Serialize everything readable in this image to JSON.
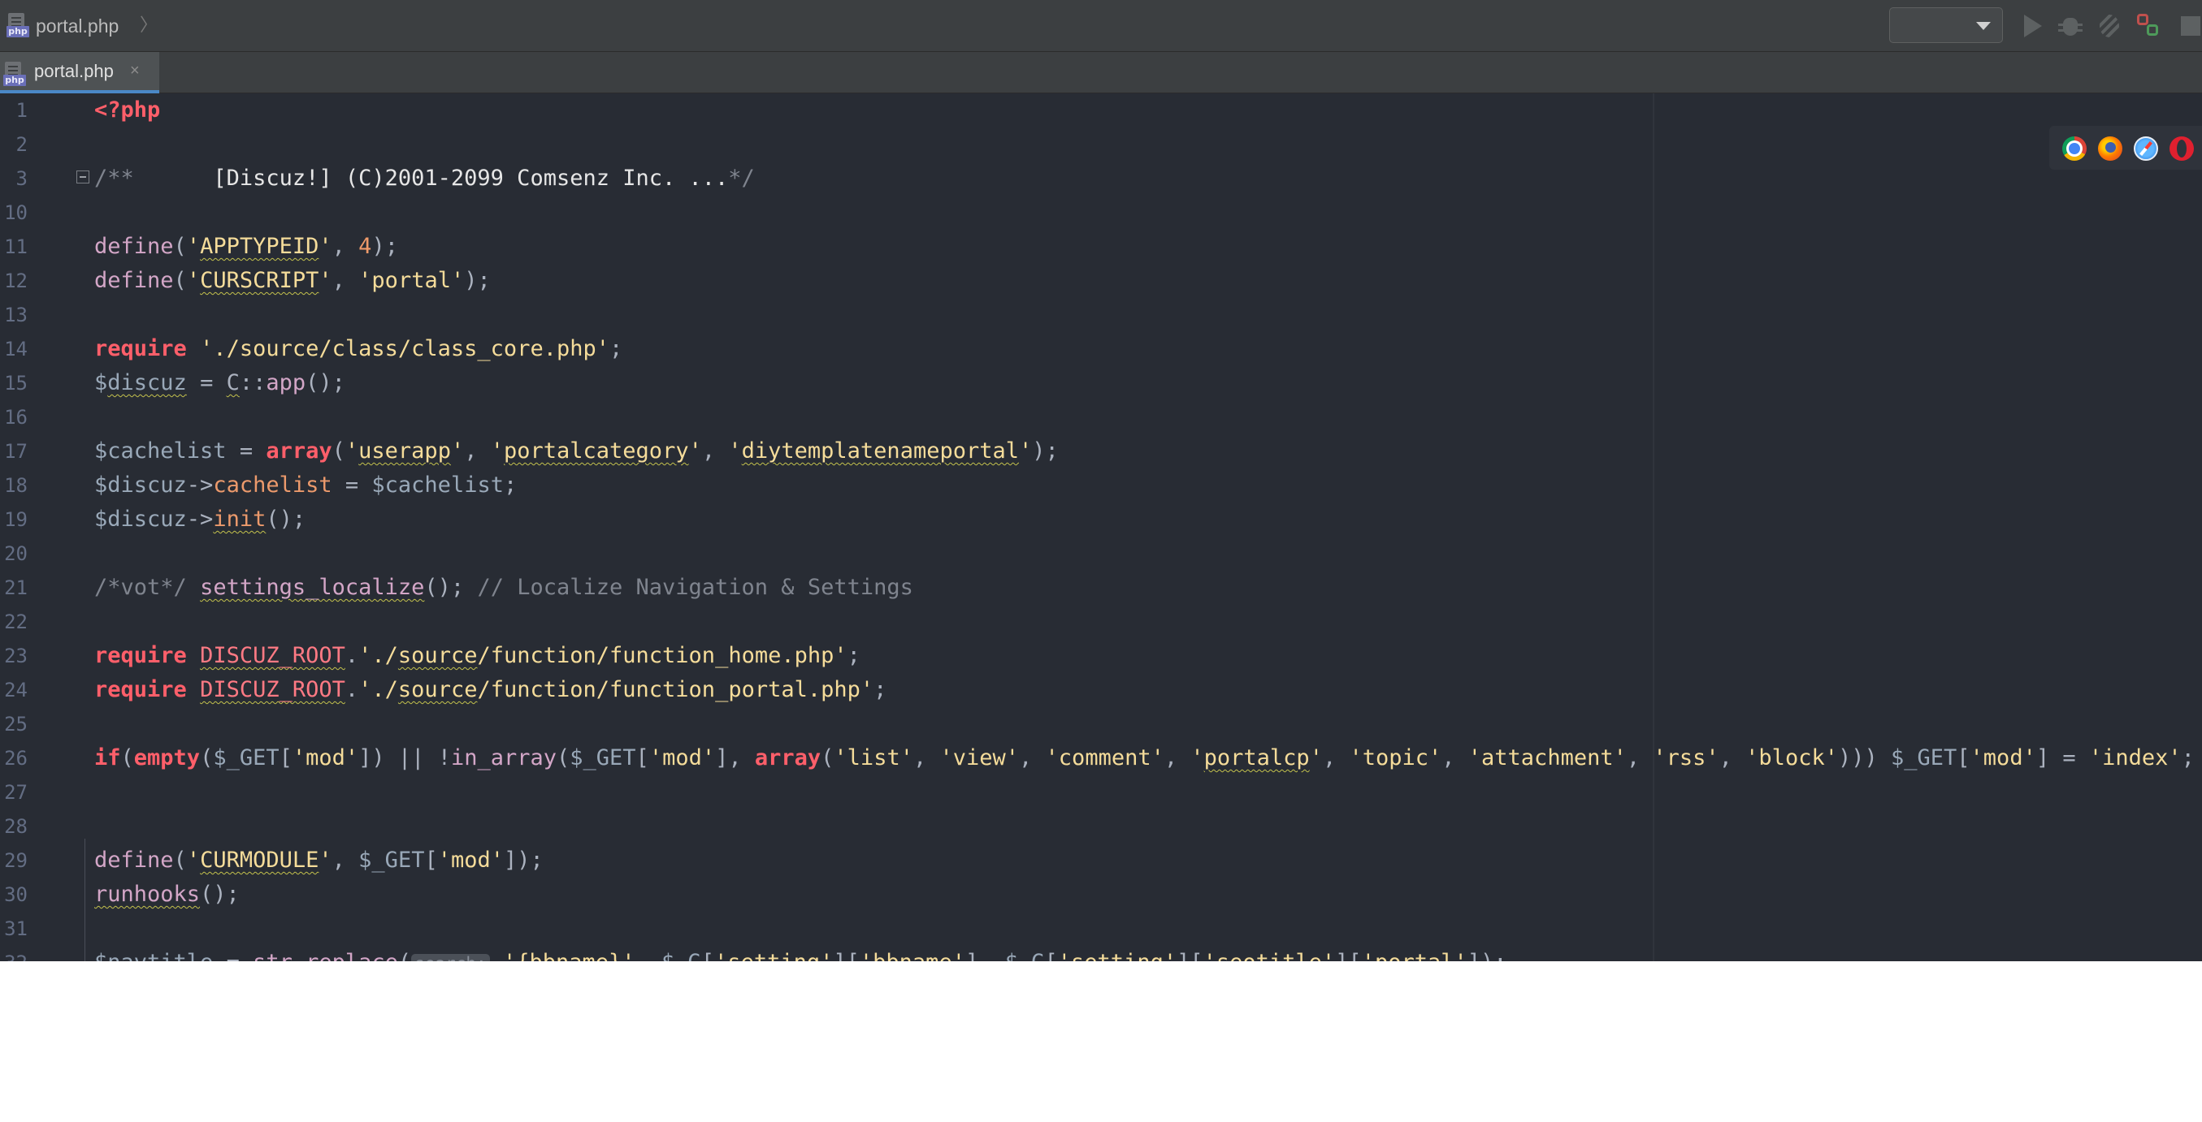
{
  "navbar": {
    "file_icon": "php-file-icon",
    "file_icon_tag": "php",
    "breadcrumb_file": "portal.php",
    "separator": "〉",
    "toolbar_icons": [
      "run-config-dropdown",
      "run-icon",
      "debug-icon",
      "profile-icon",
      "coverage-icon",
      "stop-icon"
    ]
  },
  "tabs": [
    {
      "label": "portal.php",
      "close": "×",
      "active": true,
      "icon": "php-file-icon"
    }
  ],
  "browser_icons": [
    "chrome-icon",
    "firefox-icon",
    "safari-icon",
    "opera-icon"
  ],
  "editor": {
    "lines": [
      {
        "no": "1",
        "tokens": [
          {
            "t": "<?php",
            "c": "kw"
          }
        ]
      },
      {
        "no": "2",
        "tokens": []
      },
      {
        "no": "3",
        "tokens": [
          {
            "t": "/**",
            "c": "cm"
          },
          {
            "t": "      [Discuz!] (C)2001-2099 Comsenz Inc. ...",
            "c": "cf"
          },
          {
            "t": "*/",
            "c": "cm"
          }
        ]
      },
      {
        "no": "10",
        "tokens": []
      },
      {
        "no": "11",
        "tokens": [
          {
            "t": "define",
            "c": "fn"
          },
          {
            "t": "(",
            "c": "p"
          },
          {
            "t": "'",
            "c": "s"
          },
          {
            "t": "APPTYPEID",
            "c": "s w"
          },
          {
            "t": "'",
            "c": "s"
          },
          {
            "t": ", ",
            "c": "p"
          },
          {
            "t": "4",
            "c": "n"
          },
          {
            "t": ");",
            "c": "p"
          }
        ]
      },
      {
        "no": "12",
        "tokens": [
          {
            "t": "define",
            "c": "fn"
          },
          {
            "t": "(",
            "c": "p"
          },
          {
            "t": "'",
            "c": "s"
          },
          {
            "t": "CURSCRIPT",
            "c": "s w"
          },
          {
            "t": "'",
            "c": "s"
          },
          {
            "t": ", ",
            "c": "p"
          },
          {
            "t": "'portal'",
            "c": "s"
          },
          {
            "t": ");",
            "c": "p"
          }
        ]
      },
      {
        "no": "13",
        "tokens": []
      },
      {
        "no": "14",
        "tokens": [
          {
            "t": "require",
            "c": "kw"
          },
          {
            "t": " ",
            "c": "p"
          },
          {
            "t": "'./source/class/class_core.php'",
            "c": "s"
          },
          {
            "t": ";",
            "c": "p"
          }
        ]
      },
      {
        "no": "15",
        "tokens": [
          {
            "t": "$",
            "c": "v"
          },
          {
            "t": "discuz",
            "c": "v w"
          },
          {
            "t": " = ",
            "c": "p"
          },
          {
            "t": "C",
            "c": "p w"
          },
          {
            "t": "::",
            "c": "p"
          },
          {
            "t": "app",
            "c": "fn"
          },
          {
            "t": "();",
            "c": "p"
          }
        ]
      },
      {
        "no": "16",
        "tokens": []
      },
      {
        "no": "17",
        "tokens": [
          {
            "t": "$cachelist",
            "c": "v"
          },
          {
            "t": " = ",
            "c": "p"
          },
          {
            "t": "array",
            "c": "kw"
          },
          {
            "t": "(",
            "c": "p"
          },
          {
            "t": "'",
            "c": "s"
          },
          {
            "t": "userapp",
            "c": "s w"
          },
          {
            "t": "'",
            "c": "s"
          },
          {
            "t": ", ",
            "c": "p"
          },
          {
            "t": "'",
            "c": "s"
          },
          {
            "t": "portalcategory",
            "c": "s w"
          },
          {
            "t": "'",
            "c": "s"
          },
          {
            "t": ", ",
            "c": "p"
          },
          {
            "t": "'",
            "c": "s"
          },
          {
            "t": "diytemplatenameportal",
            "c": "s w"
          },
          {
            "t": "'",
            "c": "s"
          },
          {
            "t": ");",
            "c": "p"
          }
        ]
      },
      {
        "no": "18",
        "tokens": [
          {
            "t": "$discuz",
            "c": "v"
          },
          {
            "t": "->",
            "c": "p"
          },
          {
            "t": "cachelist",
            "c": "m"
          },
          {
            "t": " = ",
            "c": "p"
          },
          {
            "t": "$cachelist",
            "c": "v"
          },
          {
            "t": ";",
            "c": "p"
          }
        ]
      },
      {
        "no": "19",
        "tokens": [
          {
            "t": "$discuz",
            "c": "v"
          },
          {
            "t": "->",
            "c": "p"
          },
          {
            "t": "init",
            "c": "m w"
          },
          {
            "t": "();",
            "c": "p"
          }
        ]
      },
      {
        "no": "20",
        "tokens": []
      },
      {
        "no": "21",
        "tokens": [
          {
            "t": "/*vot*/",
            "c": "cm"
          },
          {
            "t": " ",
            "c": "p"
          },
          {
            "t": "settings_localize",
            "c": "fn w"
          },
          {
            "t": "(); ",
            "c": "p"
          },
          {
            "t": "// Localize Navigation & Settings",
            "c": "cm"
          }
        ]
      },
      {
        "no": "22",
        "tokens": []
      },
      {
        "no": "23",
        "tokens": [
          {
            "t": "require",
            "c": "kw"
          },
          {
            "t": " ",
            "c": "p"
          },
          {
            "t": "DISCUZ_ROOT",
            "c": "cn w"
          },
          {
            "t": ".",
            "c": "p"
          },
          {
            "t": "'./",
            "c": "s"
          },
          {
            "t": "source",
            "c": "s w"
          },
          {
            "t": "/function/function_home.php'",
            "c": "s"
          },
          {
            "t": ";",
            "c": "p"
          }
        ]
      },
      {
        "no": "24",
        "tokens": [
          {
            "t": "require",
            "c": "kw"
          },
          {
            "t": " ",
            "c": "p"
          },
          {
            "t": "DISCUZ_ROOT",
            "c": "cn w"
          },
          {
            "t": ".",
            "c": "p"
          },
          {
            "t": "'./",
            "c": "s"
          },
          {
            "t": "source",
            "c": "s w"
          },
          {
            "t": "/function/function_portal.php'",
            "c": "s"
          },
          {
            "t": ";",
            "c": "p"
          }
        ]
      },
      {
        "no": "25",
        "tokens": []
      },
      {
        "no": "26",
        "tokens": [
          {
            "t": "if",
            "c": "kw"
          },
          {
            "t": "(",
            "c": "p"
          },
          {
            "t": "empty",
            "c": "kw"
          },
          {
            "t": "(",
            "c": "p"
          },
          {
            "t": "$_GET",
            "c": "v"
          },
          {
            "t": "[",
            "c": "p"
          },
          {
            "t": "'mod'",
            "c": "s"
          },
          {
            "t": "]) || !",
            "c": "p"
          },
          {
            "t": "in_array",
            "c": "fn"
          },
          {
            "t": "(",
            "c": "p"
          },
          {
            "t": "$_GET",
            "c": "v"
          },
          {
            "t": "[",
            "c": "p"
          },
          {
            "t": "'mod'",
            "c": "s"
          },
          {
            "t": "], ",
            "c": "p"
          },
          {
            "t": "array",
            "c": "kw"
          },
          {
            "t": "(",
            "c": "p"
          },
          {
            "t": "'list'",
            "c": "s"
          },
          {
            "t": ", ",
            "c": "p"
          },
          {
            "t": "'view'",
            "c": "s"
          },
          {
            "t": ", ",
            "c": "p"
          },
          {
            "t": "'comment'",
            "c": "s"
          },
          {
            "t": ", ",
            "c": "p"
          },
          {
            "t": "'",
            "c": "s"
          },
          {
            "t": "portalcp",
            "c": "s w"
          },
          {
            "t": "'",
            "c": "s"
          },
          {
            "t": ", ",
            "c": "p"
          },
          {
            "t": "'topic'",
            "c": "s"
          },
          {
            "t": ", ",
            "c": "p"
          },
          {
            "t": "'attachment'",
            "c": "s"
          },
          {
            "t": ", ",
            "c": "p"
          },
          {
            "t": "'rss'",
            "c": "s"
          },
          {
            "t": ", ",
            "c": "p"
          },
          {
            "t": "'block'",
            "c": "s"
          },
          {
            "t": "))) ",
            "c": "p"
          },
          {
            "t": "$_GET",
            "c": "v"
          },
          {
            "t": "[",
            "c": "p"
          },
          {
            "t": "'mod'",
            "c": "s"
          },
          {
            "t": "] = ",
            "c": "p"
          },
          {
            "t": "'index'",
            "c": "s"
          },
          {
            "t": ";",
            "c": "p"
          }
        ]
      },
      {
        "no": "27",
        "tokens": []
      },
      {
        "no": "28",
        "tokens": []
      },
      {
        "no": "29",
        "tokens": [
          {
            "t": "define",
            "c": "fn"
          },
          {
            "t": "(",
            "c": "p"
          },
          {
            "t": "'",
            "c": "s"
          },
          {
            "t": "CURMODULE",
            "c": "s w"
          },
          {
            "t": "'",
            "c": "s"
          },
          {
            "t": ", ",
            "c": "p"
          },
          {
            "t": "$_GET",
            "c": "v"
          },
          {
            "t": "[",
            "c": "p"
          },
          {
            "t": "'mod'",
            "c": "s"
          },
          {
            "t": "]);",
            "c": "p"
          }
        ]
      },
      {
        "no": "30",
        "tokens": [
          {
            "t": "runhooks",
            "c": "fn w"
          },
          {
            "t": "();",
            "c": "p"
          }
        ]
      },
      {
        "no": "31",
        "tokens": []
      },
      {
        "no": "32",
        "tokens": [
          {
            "t": "$navtitle",
            "c": "v"
          },
          {
            "t": " = ",
            "c": "p"
          },
          {
            "t": "str_replace",
            "c": "fn"
          },
          {
            "t": "(",
            "c": "p"
          },
          {
            "t": "search:",
            "c": "hint"
          },
          {
            "t": " ",
            "c": "p"
          },
          {
            "t": "'{bbname}'",
            "c": "s"
          },
          {
            "t": ", ",
            "c": "p"
          },
          {
            "t": "$_G",
            "c": "v"
          },
          {
            "t": "[",
            "c": "p"
          },
          {
            "t": "'setting'",
            "c": "s"
          },
          {
            "t": "][",
            "c": "p"
          },
          {
            "t": "'bbname'",
            "c": "s"
          },
          {
            "t": "], ",
            "c": "p"
          },
          {
            "t": "$_G",
            "c": "v"
          },
          {
            "t": "[",
            "c": "p"
          },
          {
            "t": "'setting'",
            "c": "s"
          },
          {
            "t": "][",
            "c": "p"
          },
          {
            "t": "'seotitle'",
            "c": "s"
          },
          {
            "t": "][",
            "c": "p"
          },
          {
            "t": "'portal'",
            "c": "s"
          },
          {
            "t": "]);",
            "c": "p"
          }
        ]
      }
    ]
  }
}
